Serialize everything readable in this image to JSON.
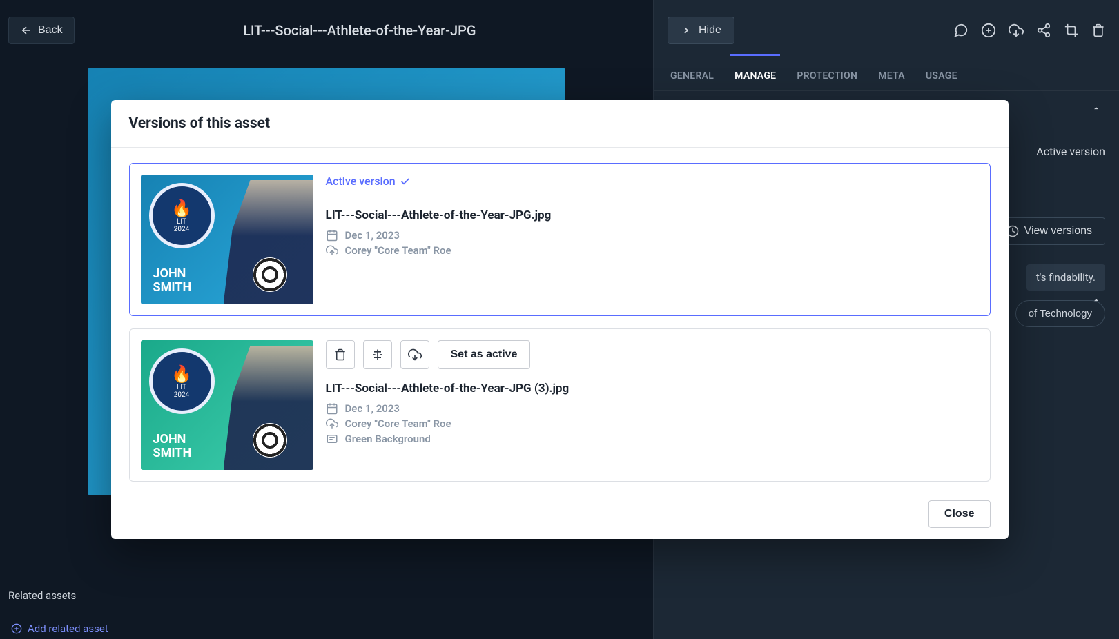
{
  "header": {
    "back_label": "Back",
    "title": "LIT---Social---Athlete-of-the-Year-JPG",
    "hide_label": "Hide"
  },
  "tabs": [
    "GENERAL",
    "MANAGE",
    "PROTECTION",
    "META",
    "USAGE"
  ],
  "active_tab": "MANAGE",
  "side": {
    "active_version": "Active version",
    "view_versions": "View versions",
    "findability_hint": "t's findability.",
    "tag_pill": "of Technology"
  },
  "related": {
    "title": "Related assets",
    "add_label": "Add related asset"
  },
  "modal": {
    "title": "Versions of this asset",
    "close_label": "Close",
    "set_active_label": "Set as active",
    "active_version_label": "Active version",
    "versions": [
      {
        "filename": "LIT---Social---Athlete-of-the-Year-JPG.jpg",
        "date": "Dec 1, 2023",
        "uploader": "Corey \"Core Team\" Roe",
        "active": true,
        "thumb_color": "blue",
        "player_first": "JOHN",
        "player_last": "SMITH",
        "badge_text": "LIT",
        "badge_year": "2024"
      },
      {
        "filename": "LIT---Social---Athlete-of-the-Year-JPG (3).jpg",
        "date": "Dec 1, 2023",
        "uploader": "Corey \"Core Team\" Roe",
        "note": "Green Background",
        "active": false,
        "thumb_color": "green",
        "player_first": "JOHN",
        "player_last": "SMITH",
        "badge_text": "LIT",
        "badge_year": "2024"
      }
    ]
  }
}
